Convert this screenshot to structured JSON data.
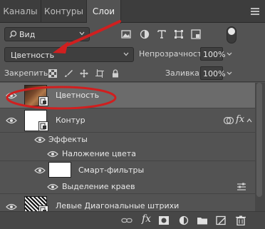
{
  "tabs": [
    {
      "label": "Каналы",
      "active": false
    },
    {
      "label": "Контуры",
      "active": false
    },
    {
      "label": "Слои",
      "active": true
    }
  ],
  "filter": {
    "kind_label": "Вид",
    "icons": [
      "image-filter-icon",
      "adjustment-filter-icon",
      "type-filter-icon",
      "shape-filter-icon",
      "smart-object-filter-icon"
    ]
  },
  "blend": {
    "mode": "Цветность",
    "opacity_label": "Непрозрачность:",
    "opacity_value": "100%"
  },
  "lock": {
    "label": "Закрепить:",
    "fill_label": "Заливка:",
    "fill_value": "100%"
  },
  "layers": [
    {
      "name": "Цветность",
      "selected": true,
      "visible": true
    },
    {
      "name": "Контур",
      "selected": false,
      "visible": true,
      "effects_label": "Эффекты",
      "effect_items": [
        "Наложение цвета"
      ]
    },
    {
      "name": "Смарт-фильтры",
      "sub_items": [
        "Выделение краев"
      ]
    },
    {
      "name": "Левые Диагональные штрихи",
      "selected": false,
      "visible": true
    }
  ],
  "colors": {
    "panel_bg": "#535353",
    "tab_bg": "#3d3d3d",
    "selected_row": "#6b6b6b",
    "annotation_red": "#d01f1f"
  }
}
